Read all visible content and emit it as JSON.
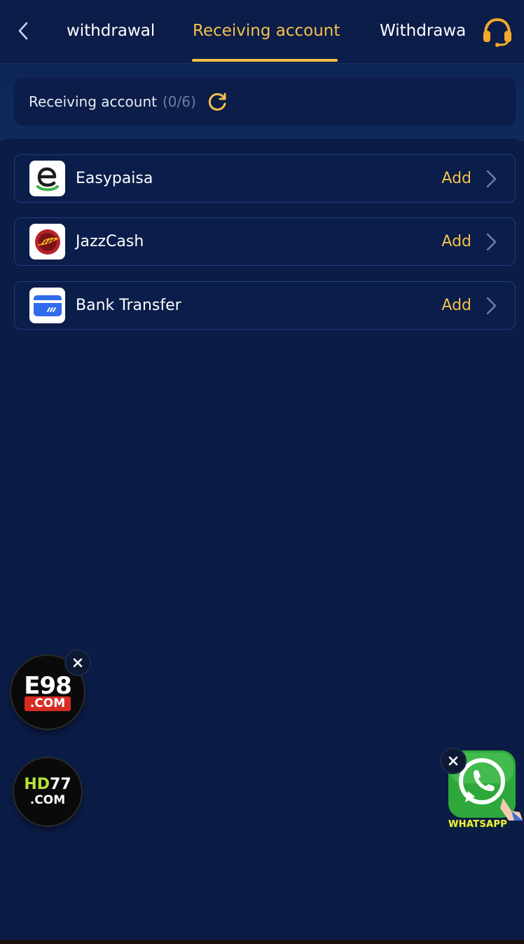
{
  "header": {
    "tabs": [
      {
        "label": "withdrawal",
        "active": false
      },
      {
        "label": "Receiving account",
        "active": true
      },
      {
        "label": "Withdrawal",
        "active": false
      }
    ]
  },
  "summary": {
    "label": "Receiving account",
    "count": "(0/6)"
  },
  "accounts": [
    {
      "name": "Easypaisa",
      "action": "Add",
      "icon": "easypaisa-logo"
    },
    {
      "name": "JazzCash",
      "action": "Add",
      "icon": "jazzcash-logo"
    },
    {
      "name": "Bank Transfer",
      "action": "Add",
      "icon": "bank-card-icon"
    }
  ],
  "floating": {
    "e98": {
      "top": "E98",
      "bottom": ".COM"
    },
    "hd77": {
      "top_prefix": "HD",
      "top_suffix": "77",
      "bottom": ".COM"
    },
    "whatsapp": {
      "label": "WHATSAPP"
    }
  },
  "colors": {
    "background": "#0b1c47",
    "accent": "#f3c14b",
    "border": "#1f3f7c"
  }
}
